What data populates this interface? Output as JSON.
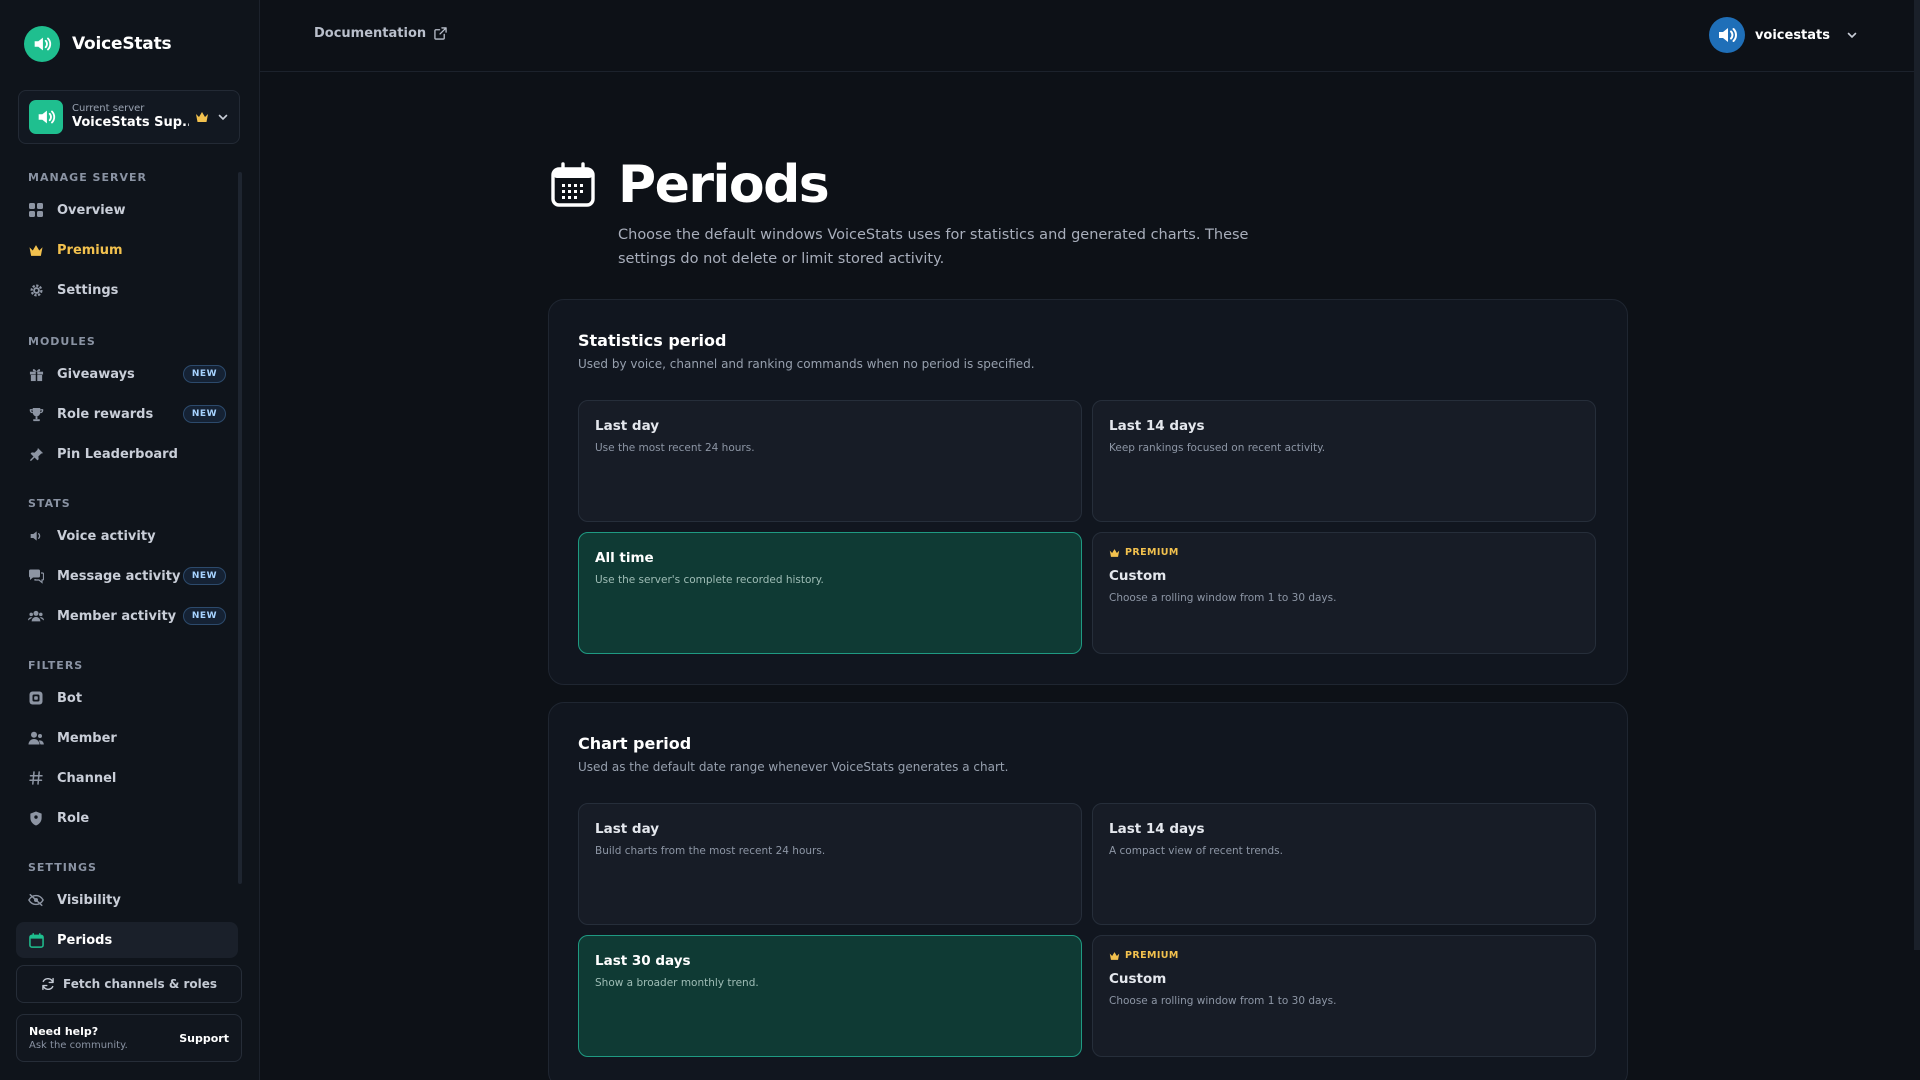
{
  "brand": {
    "name": "VoiceStats"
  },
  "colors": {
    "accent": "#1fbf8f",
    "gold": "#f2c14e",
    "selected_bg": "#0f3a34",
    "selected_border": "#1f9a82"
  },
  "server": {
    "caption": "Current server",
    "name": "VoiceStats Sup..."
  },
  "sections": {
    "manage": "MANAGE SERVER",
    "modules": "MODULES",
    "stats": "STATS",
    "filters": "FILTERS",
    "settings": "SETTINGS"
  },
  "nav": {
    "overview": "Overview",
    "premium": "Premium",
    "settings": "Settings",
    "giveaways": "Giveaways",
    "role_rewards": "Role rewards",
    "pin_leaderboard": "Pin Leaderboard",
    "voice_activity": "Voice activity",
    "message_activity": "Message activity",
    "member_activity": "Member activity",
    "bot": "Bot",
    "member": "Member",
    "channel": "Channel",
    "role": "Role",
    "visibility": "Visibility",
    "periods": "Periods",
    "new_badge": "NEW"
  },
  "sidebar_footer": {
    "fetch_label": "Fetch channels & roles",
    "help_title": "Need help?",
    "help_sub": "Ask the community.",
    "support_label": "Support"
  },
  "topbar": {
    "documentation": "Documentation",
    "username": "voicestats"
  },
  "page": {
    "title": "Periods",
    "description": "Choose the default windows VoiceStats uses for statistics and generated charts. These settings do not delete or limit stored activity."
  },
  "statistics_period": {
    "title": "Statistics period",
    "subtitle": "Used by voice, channel and ranking commands when no period is specified.",
    "options": [
      {
        "title": "Last day",
        "desc": "Use the most recent 24 hours."
      },
      {
        "title": "Last 14 days",
        "desc": "Keep rankings focused on recent activity."
      },
      {
        "title": "All time",
        "desc": "Use the server's complete recorded history."
      },
      {
        "tag": "PREMIUM",
        "title": "Custom",
        "desc": "Choose a rolling window from 1 to 30 days."
      }
    ]
  },
  "chart_period": {
    "title": "Chart period",
    "subtitle": "Used as the default date range whenever VoiceStats generates a chart.",
    "options": [
      {
        "title": "Last day",
        "desc": "Build charts from the most recent 24 hours."
      },
      {
        "title": "Last 14 days",
        "desc": "A compact view of recent trends."
      },
      {
        "title": "Last 30 days",
        "desc": "Show a broader monthly trend."
      },
      {
        "tag": "PREMIUM",
        "title": "Custom",
        "desc": "Choose a rolling window from 1 to 30 days."
      }
    ]
  }
}
